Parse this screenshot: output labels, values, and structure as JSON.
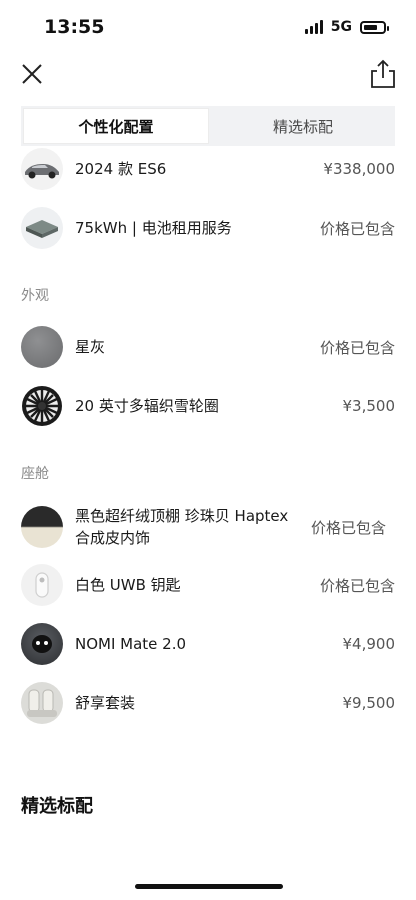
{
  "status": {
    "time": "13:55",
    "network": "5G"
  },
  "tabs": [
    {
      "label": "个性化配置",
      "active": true
    },
    {
      "label": "精选标配",
      "active": false
    }
  ],
  "items_top": [
    {
      "name": "2024 款 ES6",
      "price": "¥338,000",
      "thumb": "car-thumbnail"
    },
    {
      "name": "75kWh | 电池租用服务",
      "price": "价格已包含",
      "thumb": "battery-thumbnail"
    }
  ],
  "sections": {
    "exterior": {
      "title": "外观",
      "items": [
        {
          "name": "星灰",
          "price": "价格已包含",
          "thumb": "grey-paint-swatch"
        },
        {
          "name": "20 英寸多辐织雪轮圈",
          "price": "¥3,500",
          "thumb": "wheel-thumbnail"
        }
      ]
    },
    "cabin": {
      "title": "座舱",
      "items": [
        {
          "name": "黑色超纤绒顶棚 珍珠贝 Haptex合成皮内饰",
          "price": "价格已包含",
          "thumb": "interior-color-swatch"
        },
        {
          "name": "白色 UWB 钥匙",
          "price": "价格已包含",
          "thumb": "key-thumbnail"
        },
        {
          "name": "NOMI Mate 2.0",
          "price": "¥4,900",
          "thumb": "nomi-thumbnail"
        },
        {
          "name": "舒享套装",
          "price": "¥9,500",
          "thumb": "seat-thumbnail"
        }
      ]
    }
  },
  "bottom_title": "精选标配",
  "colors": {
    "grey_paint": "#7b7c7e",
    "tab_bg": "#f1f2f4"
  }
}
